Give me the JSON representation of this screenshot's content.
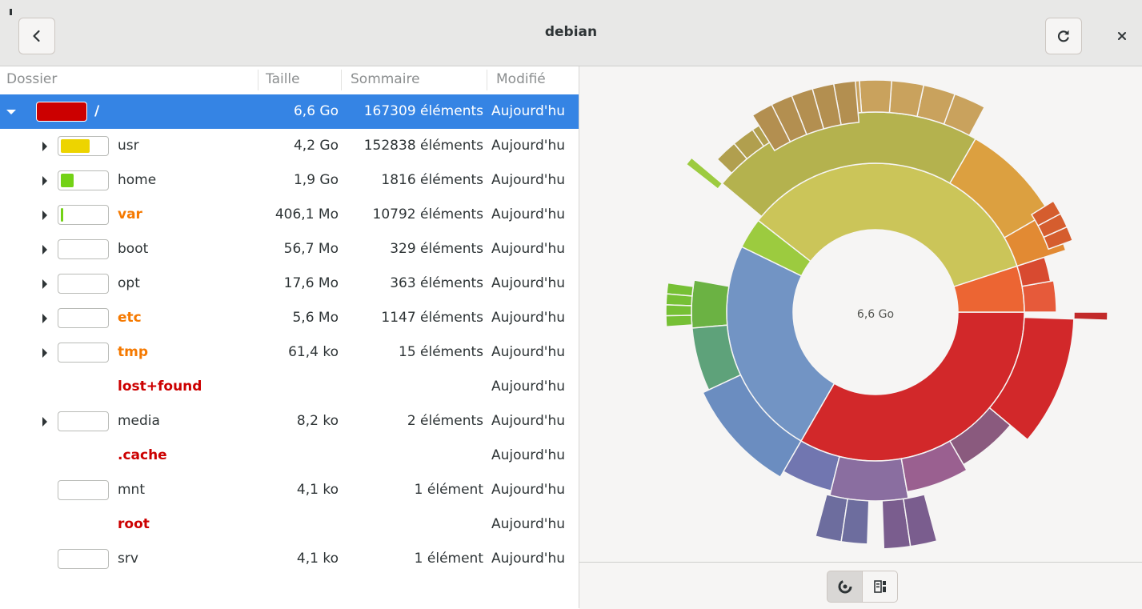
{
  "window": {
    "title": "debian"
  },
  "columns": {
    "folder": "Dossier",
    "size": "Taille",
    "summary": "Sommaire",
    "modified": "Modifié"
  },
  "rows": [
    {
      "name": "/",
      "size": "6,6 Go",
      "summary": "167309 éléments",
      "modified": "Aujourd'hu",
      "usage": 1.0,
      "color": "#cc0000",
      "style": "selected",
      "expander": "expanded"
    },
    {
      "name": "usr",
      "size": "4,2 Go",
      "summary": "152838 éléments",
      "modified": "Aujourd'hu",
      "usage": 0.64,
      "color": "#edd400",
      "style": "normal",
      "expander": "collapsed"
    },
    {
      "name": "home",
      "size": "1,9 Go",
      "summary": "1816 éléments",
      "modified": "Aujourd'hu",
      "usage": 0.28,
      "color": "#73d216",
      "style": "normal",
      "expander": "collapsed"
    },
    {
      "name": "var",
      "size": "406,1 Mo",
      "summary": "10792 éléments",
      "modified": "Aujourd'hu",
      "usage": 0.06,
      "color": "#73d216",
      "style": "orange",
      "expander": "collapsed"
    },
    {
      "name": "boot",
      "size": "56,7 Mo",
      "summary": "329 éléments",
      "modified": "Aujourd'hu",
      "usage": 0.0,
      "color": "#73d216",
      "style": "normal",
      "expander": "collapsed"
    },
    {
      "name": "opt",
      "size": "17,6 Mo",
      "summary": "363 éléments",
      "modified": "Aujourd'hu",
      "usage": 0.0,
      "color": "#73d216",
      "style": "normal",
      "expander": "collapsed"
    },
    {
      "name": "etc",
      "size": "5,6 Mo",
      "summary": "1147 éléments",
      "modified": "Aujourd'hu",
      "usage": 0.0,
      "color": "#73d216",
      "style": "orange",
      "expander": "collapsed"
    },
    {
      "name": "tmp",
      "size": "61,4 ko",
      "summary": "15 éléments",
      "modified": "Aujourd'hu",
      "usage": 0.0,
      "color": "#73d216",
      "style": "orange",
      "expander": "collapsed"
    },
    {
      "name": "lost+found",
      "size": "",
      "summary": "",
      "modified": "Aujourd'hu",
      "usage": null,
      "color": "",
      "style": "red",
      "expander": "none"
    },
    {
      "name": "media",
      "size": "8,2 ko",
      "summary": "2 éléments",
      "modified": "Aujourd'hu",
      "usage": 0.0,
      "color": "#73d216",
      "style": "normal",
      "expander": "collapsed"
    },
    {
      "name": ".cache",
      "size": "",
      "summary": "",
      "modified": "Aujourd'hu",
      "usage": null,
      "color": "",
      "style": "red",
      "expander": "none"
    },
    {
      "name": "mnt",
      "size": "4,1 ko",
      "summary": "1 élément",
      "modified": "Aujourd'hu",
      "usage": 0.0,
      "color": "#73d216",
      "style": "normal",
      "expander": "none"
    },
    {
      "name": "root",
      "size": "",
      "summary": "",
      "modified": "Aujourd'hu",
      "usage": null,
      "color": "",
      "style": "red",
      "expander": "none"
    },
    {
      "name": "srv",
      "size": "4,1 ko",
      "summary": "1 élément",
      "modified": "Aujourd'hu",
      "usage": 0.0,
      "color": "#73d216",
      "style": "normal",
      "expander": "none"
    }
  ],
  "chart": {
    "center_label": "6,6 Go"
  },
  "icons": {
    "back": "go-previous-icon",
    "reload": "view-refresh-icon",
    "close": "window-close-icon",
    "rings_view": "rings-chart-icon",
    "treemap_view": "treemap-chart-icon"
  }
}
